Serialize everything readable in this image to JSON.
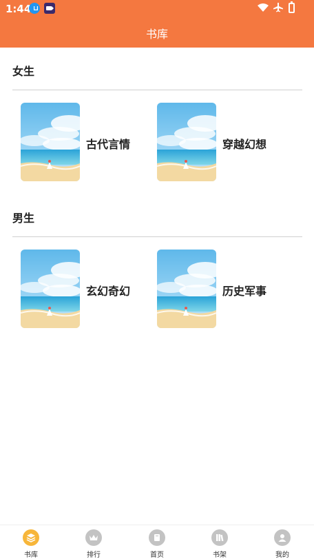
{
  "status": {
    "time": "1:44"
  },
  "header": {
    "title": "书库"
  },
  "sections": [
    {
      "title": "女生",
      "items": [
        {
          "label": "古代言情"
        },
        {
          "label": "穿越幻想"
        }
      ]
    },
    {
      "title": "男生",
      "items": [
        {
          "label": "玄幻奇幻"
        },
        {
          "label": "历史军事"
        }
      ]
    }
  ],
  "tabs": [
    {
      "label": "书库",
      "icon": "layers-icon",
      "active": true
    },
    {
      "label": "排行",
      "icon": "crown-icon",
      "active": false
    },
    {
      "label": "首页",
      "icon": "book-icon",
      "active": false
    },
    {
      "label": "书架",
      "icon": "bookshelf-icon",
      "active": false
    },
    {
      "label": "我的",
      "icon": "person-icon",
      "active": false
    }
  ],
  "colors": {
    "accent": "#F47840",
    "tab_active": "#F7B63A",
    "tab_inactive": "#c3c3c3"
  }
}
